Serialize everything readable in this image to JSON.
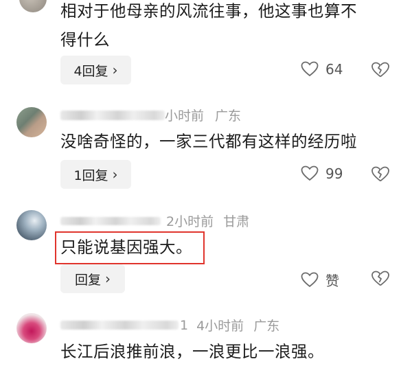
{
  "comments": [
    {
      "text_line1": "相对于他母亲的风流往事，他这事也算不",
      "text_line2": "得什么",
      "reply_label": "4回复",
      "like_count": "64"
    },
    {
      "meta_tail": "小时前",
      "location": "广东",
      "text": "没啥奇怪的，一家三代都有这样的经历啦",
      "reply_label": "1回复",
      "like_count": "99"
    },
    {
      "time": "2小时前",
      "location": "甘肃",
      "text": "只能说基因强大。",
      "reply_label": "回复",
      "like_label": "赞"
    },
    {
      "meta_tail": "1",
      "time": "4小时前",
      "location": "广东",
      "text": "长江后浪推前浪，一浪更比一浪强。"
    }
  ],
  "icons": {
    "chevron": "chevron-right-icon",
    "like": "heart-outline-icon",
    "dislike": "broken-heart-icon"
  },
  "colors": {
    "highlight": "#e0342c",
    "meta_gray": "#9a9a9a",
    "button_bg": "#f2f2f2"
  }
}
